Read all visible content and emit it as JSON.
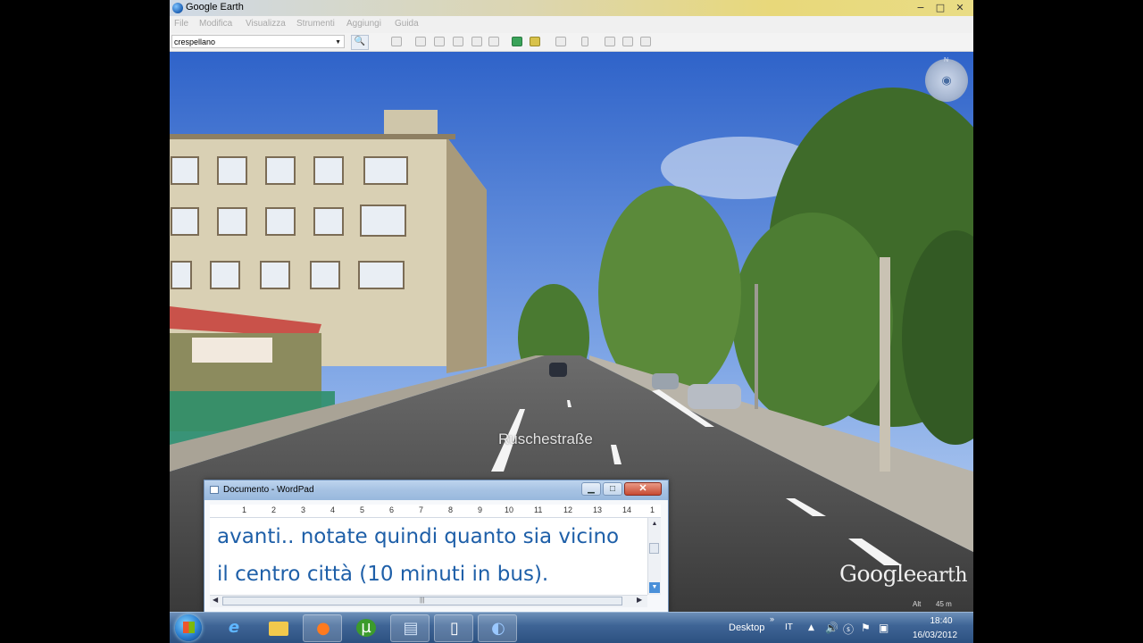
{
  "ge_window": {
    "title": "Google Earth",
    "controls": [
      "−",
      "□",
      "✕"
    ],
    "menu": [
      "File",
      "Modifica",
      "Visualizza",
      "Strumenti",
      "Aggiungi",
      "Guida"
    ],
    "search": {
      "value": "crespellano",
      "button": "🔍"
    }
  },
  "street_view": {
    "street_name": "Ruschestraße",
    "compass_north": "N",
    "logo_brand": "Google",
    "logo_suffix": "earth",
    "altitude_label": "Alt",
    "altitude_value": "45 m"
  },
  "wordpad": {
    "title": "Documento - WordPad",
    "ruler_numbers": [
      "1",
      "2",
      "3",
      "4",
      "5",
      "6",
      "7",
      "8",
      "9",
      "10",
      "11",
      "12",
      "13",
      "14",
      "1"
    ],
    "lines": [
      "avanti.. notate quindi quanto sia vicino",
      "il centro città (10 minuti in bus)."
    ],
    "text_color": "#1e5fa8"
  },
  "taskbar": {
    "apps": [
      {
        "name": "internet-explorer-icon",
        "glyph": "e",
        "color": "#2a8ad8"
      },
      {
        "name": "file-explorer-icon",
        "glyph": "📁",
        "color": "#f2c94c"
      },
      {
        "name": "firefox-icon",
        "glyph": "●",
        "color": "#e66a1e"
      },
      {
        "name": "utorrent-icon",
        "glyph": "µ",
        "color": "#3c9b2c"
      },
      {
        "name": "wordpad-icon",
        "glyph": "▤",
        "color": "#cfe0f5"
      },
      {
        "name": "document-icon",
        "glyph": "▯",
        "color": "#ffffff"
      },
      {
        "name": "google-earth-icon",
        "glyph": "◐",
        "color": "#2f6fd0"
      }
    ],
    "desktop_label": "Desktop",
    "language": "IT",
    "time": "18:40",
    "date": "16/03/2012"
  }
}
